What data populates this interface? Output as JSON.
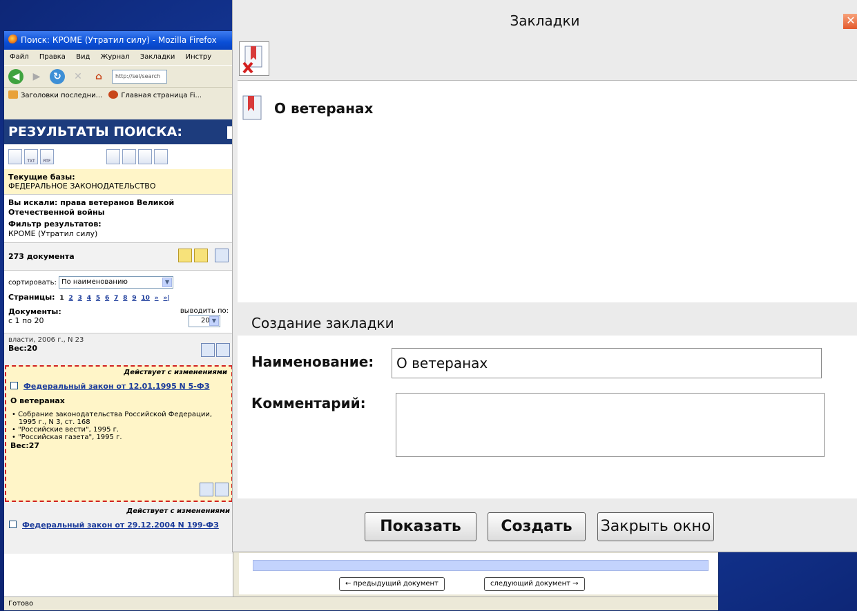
{
  "browser": {
    "title": "Поиск: КРОМЕ (Утратил силу) - Mozilla Firefox",
    "menu": [
      "Файл",
      "Правка",
      "Вид",
      "Журнал",
      "Закладки",
      "Инстру"
    ],
    "url": "http://sel/search",
    "bookmarks": [
      "Заголовки последни...",
      "Главная страница Fi..."
    ],
    "status": "Готово"
  },
  "search": {
    "header": "РЕЗУЛЬТАТЫ ПОИСКА:",
    "bases_label": "Текущие базы:",
    "bases_value": "ФЕДЕРАЛЬНОЕ ЗАКОНОДАТЕЛЬСТВО",
    "query_label": "Вы искали: права ветеранов Великой Отечественной войны",
    "filter_label": "Фильтр результатов:",
    "filter_value": "КРОМЕ (Утратил силу)",
    "count": "273 документа",
    "sort_label": "сортировать:",
    "sort_value": "По наименованию",
    "pages_label": "Страницы:",
    "pages": [
      "1",
      "2",
      "3",
      "4",
      "5",
      "6",
      "7",
      "8",
      "9",
      "10",
      "»",
      "»|"
    ],
    "docs_label": "Документы:",
    "docs_range": "с 1 по 20",
    "perpage_label": "выводить по:",
    "perpage_value": "20",
    "prev_cut": "власти, 2006 г., N 23",
    "prev_weight": "Вес:20",
    "item1": {
      "status": "Действует с изменениями",
      "link": "Федеральный закон от 12.01.1995 N 5-ФЗ",
      "name": "О ветеранах",
      "sources": [
        "Собрание законодательства Российской Федерации, 1995 г., N 3, ст. 168",
        "\"Российские вести\", 1995 г.",
        "\"Российская газета\", 1995 г."
      ],
      "weight": "Вес:27"
    },
    "item2": {
      "status": "Действует с изменениями",
      "link": "Федеральный закон от 29.12.2004 N 199-ФЗ"
    }
  },
  "docnav": {
    "prev": "← предыдущий документ",
    "next": "следующий документ →"
  },
  "dialog": {
    "title": "Закладки",
    "bookmark_item": "О ветеранах",
    "create_header": "Создание закладки",
    "name_label": "Наименование:",
    "name_value": "О ветеранах",
    "comment_label": "Комментарий:",
    "comment_value": "",
    "btn_show": "Показать",
    "btn_create": "Создать",
    "btn_close": "Закрыть окно"
  }
}
